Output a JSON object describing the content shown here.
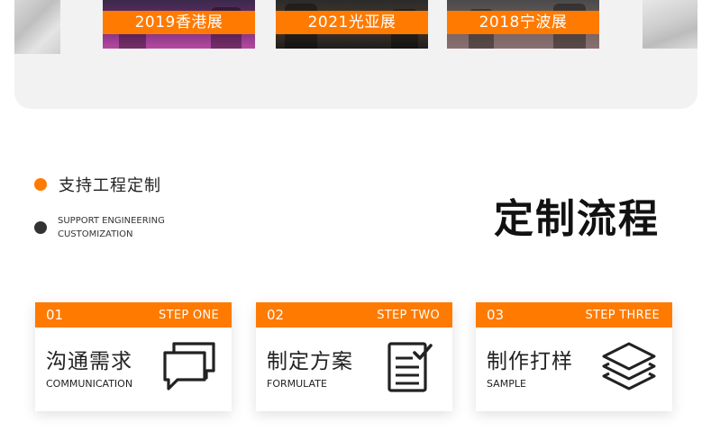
{
  "gallery": {
    "items": [
      {
        "caption": "2019香港展"
      },
      {
        "caption": "2021光亚展"
      },
      {
        "caption": "2018宁波展"
      }
    ]
  },
  "section": {
    "feature_cn": "支持工程定制",
    "feature_en_line1": "SUPPORT ENGINEERING",
    "feature_en_line2": "CUSTOMIZATION",
    "title": "定制流程"
  },
  "steps": [
    {
      "num": "01",
      "step": "STEP ONE",
      "cn": "沟通需求",
      "en": "COMMUNICATION",
      "icon": "chat-bubbles-icon"
    },
    {
      "num": "02",
      "step": "STEP TWO",
      "cn": "制定方案",
      "en": "FORMULATE",
      "icon": "checklist-document-icon"
    },
    {
      "num": "03",
      "step": "STEP THREE",
      "cn": "制作打样",
      "en": "SAMPLE",
      "icon": "layers-stack-icon"
    }
  ],
  "colors": {
    "accent": "#ff7a00",
    "dark": "#333333",
    "panel": "#f2f2f2"
  }
}
